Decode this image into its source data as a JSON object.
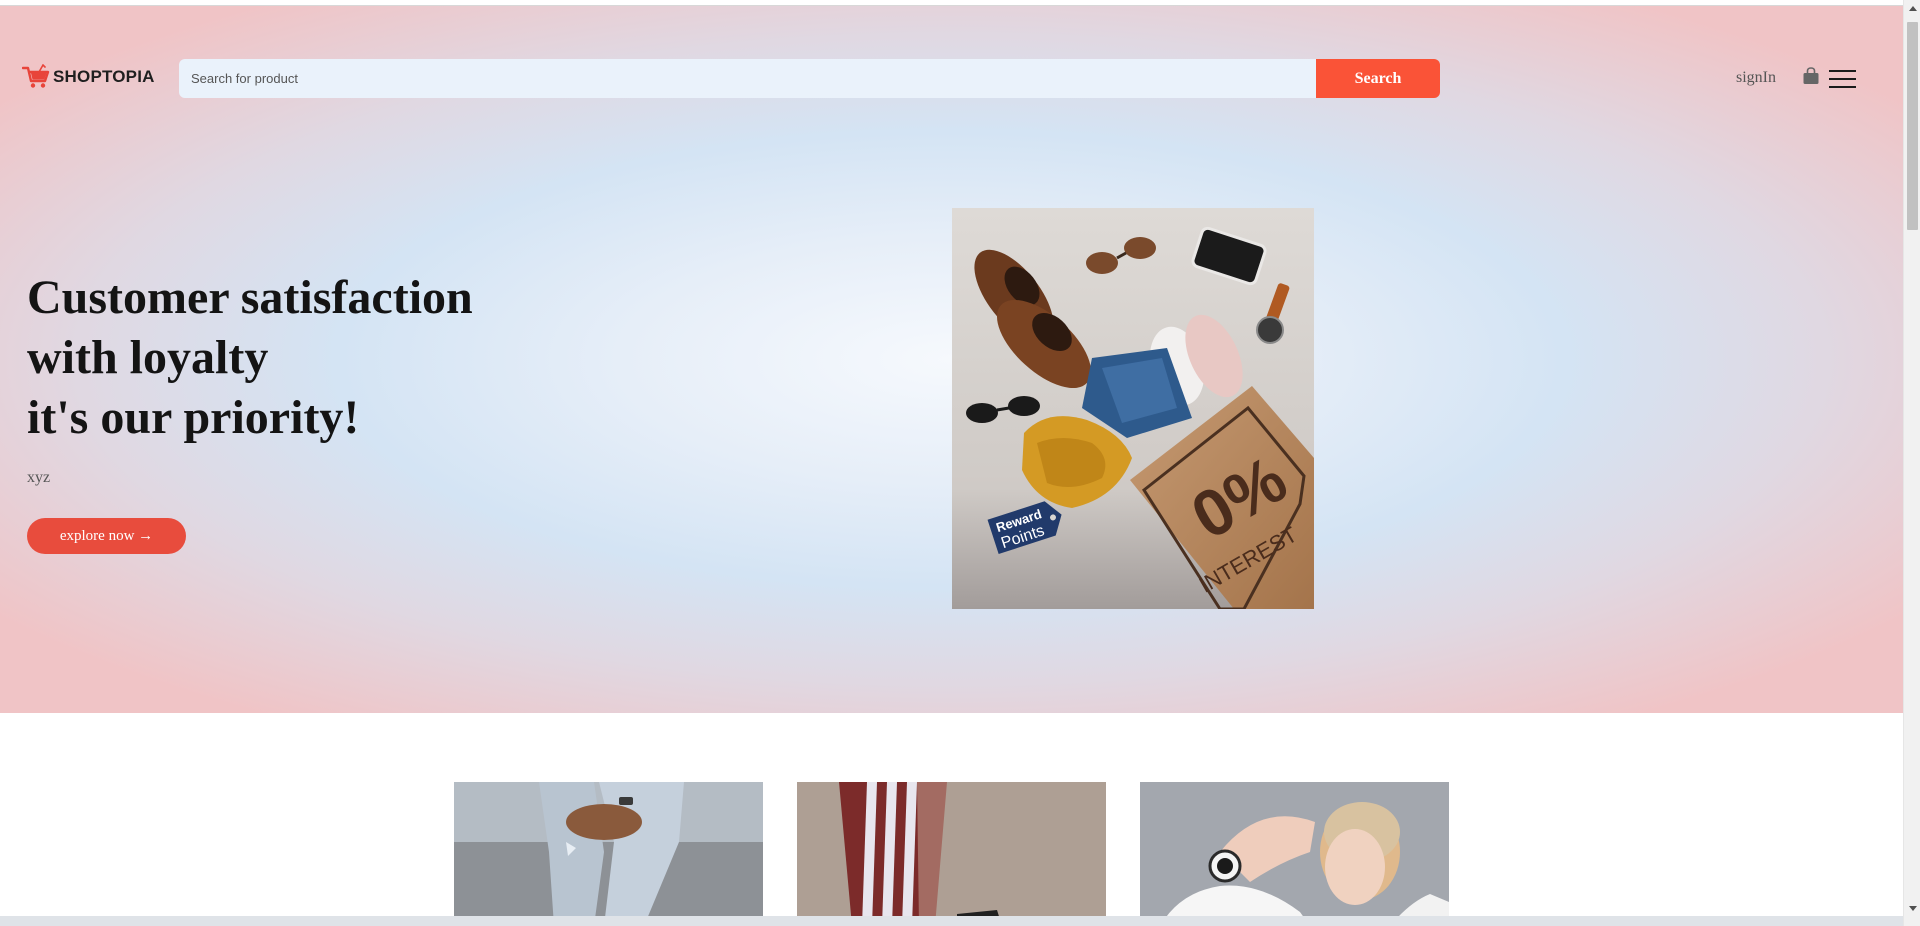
{
  "brand": {
    "name": "SHOPTOPIA",
    "logo_icon": "shopping-cart-icon",
    "accent": "#fa5337"
  },
  "search": {
    "placeholder": "Search for product",
    "value": "",
    "button_label": "Search"
  },
  "nav": {
    "signin_label": "signIn",
    "bag_icon": "shopping-bag-icon",
    "menu_icon": "hamburger-menu-icon"
  },
  "hero": {
    "headline": [
      "Customer satisfaction",
      "with loyalty",
      "it's our priority!"
    ],
    "subtext": "xyz",
    "cta_label": "explore now →",
    "cta_color": "#e84c3d",
    "image": {
      "bag_big": "0%",
      "bag_small": "INTEREST",
      "tag_line1": "Reward",
      "tag_line2": "Points"
    }
  },
  "products": [
    {
      "name": "jeans-sneakers-photo"
    },
    {
      "name": "track-pants-photo"
    },
    {
      "name": "smartwatch-woman-photo"
    }
  ],
  "colors": {
    "hero_center": "#f6f9fd",
    "hero_blue": "#d4e4f4",
    "hero_edge": "#f0c4c6",
    "search_bg": "#eaf2fb"
  }
}
